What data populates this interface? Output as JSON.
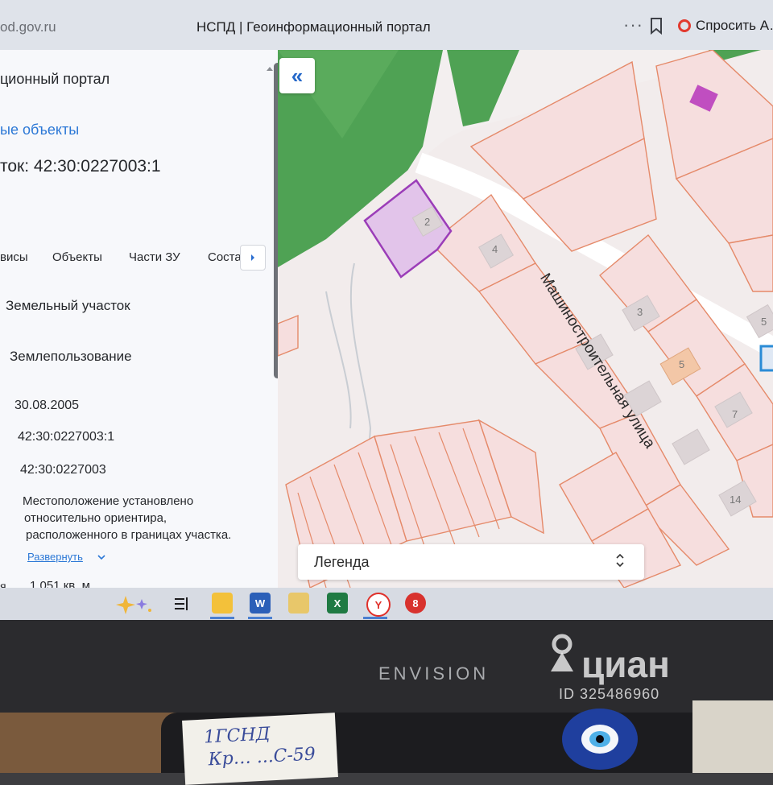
{
  "browser": {
    "url": "od.gov.ru",
    "tab_title": "НСПД | Геоинформационный портал",
    "menu_dots": "···",
    "ask_label": "Спросить А…"
  },
  "panel": {
    "portal_title": "ционный портал",
    "breadcrumb": "ые объекты",
    "parcel_heading": "ток: 42:30:0227003:1",
    "tabs": [
      "висы",
      "Объекты",
      "Части ЗУ",
      "Соста"
    ],
    "rows": [
      "Земельный участок",
      "Землепользование",
      "30.08.2005",
      "42:30:0227003:1",
      "42:30:0227003",
      "Местоположение установлено",
      "относительно ориентира,",
      "расположенного в границах участка."
    ],
    "expand_label": "Развернуть",
    "area_label": "я",
    "area_value": "1 051 кв. м"
  },
  "map": {
    "collapse_symbol": "«",
    "street_name": "Машиностроительная  улица",
    "house_numbers": [
      "2",
      "4",
      "3",
      "5",
      "7",
      "14",
      "5"
    ],
    "legend_label": "Легенда",
    "legend_toggle_symbol": "⌃⌄"
  },
  "taskbar": {
    "icons": [
      "sparkle-icon",
      "task-view-icon",
      "file-explorer-icon",
      "word-icon",
      "mail-icon",
      "excel-icon",
      "yandex-browser-icon",
      "app-8-icon"
    ],
    "word_letter": "W",
    "excel_letter": "X",
    "yandex_letter": "Y",
    "app8_letter": "8"
  },
  "monitor": {
    "brand": "ENVISION"
  },
  "watermark": {
    "name": "циан",
    "id": "ID 325486960"
  },
  "sticky_note": {
    "line1": "1ГСНД",
    "line2": "Кр…  ...С-59"
  }
}
